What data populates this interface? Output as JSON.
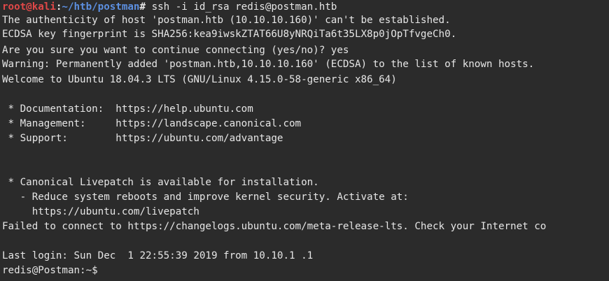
{
  "terminal": {
    "prompt": {
      "user_host": "root@kali",
      "sep": ":",
      "path": "~/htb/postman",
      "symbol": "# ",
      "command": "ssh -i id_rsa redis@postman.htb"
    },
    "lines": [
      "The authenticity of host 'postman.htb (10.10.10.160)' can't be established.",
      "ECDSA key fingerprint is SHA256:kea9iwskZTAT66U8yNRQiTa6t35LX8p0jOpTfvgeCh0.",
      "Are you sure you want to continue connecting (yes/no)? yes",
      "Warning: Permanently added 'postman.htb,10.10.10.160' (ECDSA) to the list of known hosts.",
      "Welcome to Ubuntu 18.04.3 LTS (GNU/Linux 4.15.0-58-generic x86_64)",
      " * Documentation:  https://help.ubuntu.com",
      " * Management:     https://landscape.canonical.com",
      " * Support:        https://ubuntu.com/advantage",
      " * Canonical Livepatch is available for installation.",
      "   - Reduce system reboots and improve kernel security. Activate at:",
      "     https://ubuntu.com/livepatch",
      "Failed to connect to https://changelogs.ubuntu.com/meta-release-lts. Check your Internet co",
      "Last login: Sun Dec  1 22:55:39 2019 from 10.10.1 .1",
      "redis@Postman:~$"
    ]
  },
  "colors": {
    "background": "#2b2b2b",
    "text": "#e6e6e6",
    "prompt_user": "#e04848",
    "prompt_path": "#5c8fe0"
  }
}
